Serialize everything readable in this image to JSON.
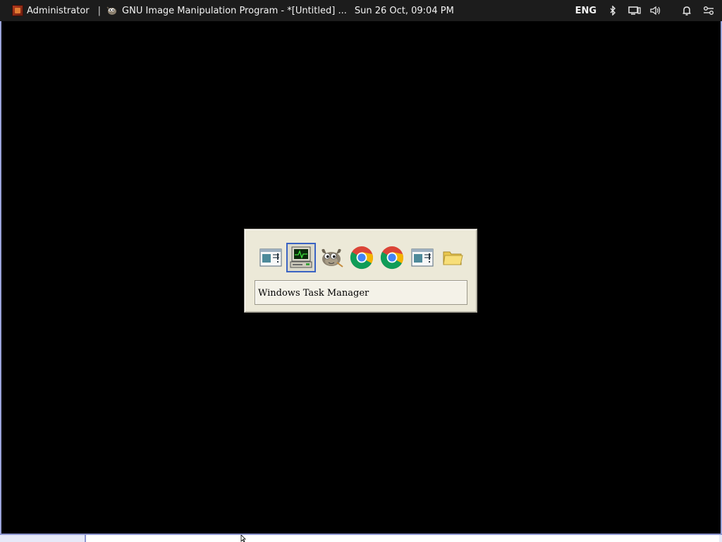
{
  "topbar": {
    "user_label": "Administrator",
    "separator": "|",
    "window_title": "GNU Image Manipulation Program - *[Untitled] ...",
    "clock": "Sun 26 Oct, 09:04 PM",
    "language": "ENG",
    "tray_icons": [
      "bluetooth-icon",
      "display-icon",
      "volume-icon",
      "notification-bell-icon",
      "settings-toggle-icon"
    ]
  },
  "switcher": {
    "selected_name": "Windows Task Manager",
    "apps": [
      {
        "icon": "generic-window-icon"
      },
      {
        "icon": "task-manager-icon",
        "selected": true
      },
      {
        "icon": "gimp-icon"
      },
      {
        "icon": "chrome-icon"
      },
      {
        "icon": "chrome-icon"
      },
      {
        "icon": "generic-window-icon"
      },
      {
        "icon": "folder-icon"
      }
    ]
  },
  "colors": {
    "topbar_bg": "#1c1c1c",
    "desktop_bg": "#000000",
    "switcher_bg": "#ece9d8",
    "selection_border": "#3a63c3",
    "window_border": "#9aa3d9"
  }
}
